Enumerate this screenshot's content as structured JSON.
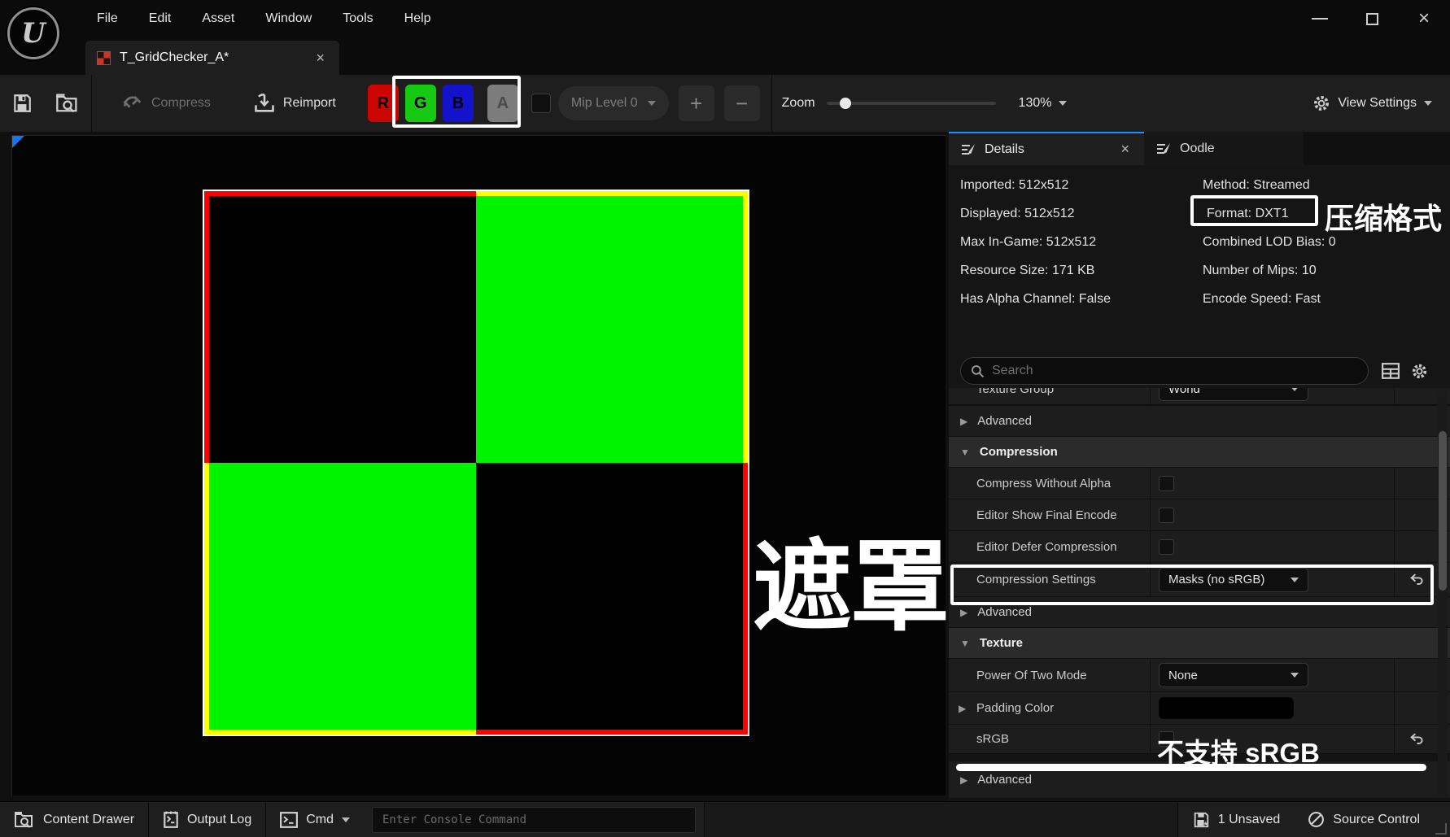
{
  "window": {
    "menu": [
      "File",
      "Edit",
      "Asset",
      "Window",
      "Tools",
      "Help"
    ],
    "logo_letter": "U"
  },
  "asset_tab": {
    "title": "T_GridChecker_A*"
  },
  "toolbar": {
    "compress_label": "Compress",
    "reimport_label": "Reimport",
    "channels": [
      {
        "label": "R",
        "color": "#cc0500"
      },
      {
        "label": "G",
        "color": "#17c913"
      },
      {
        "label": "B",
        "color": "#1512cc"
      },
      {
        "label": "A",
        "color": "#7c7c7c"
      }
    ],
    "mip_level": "Mip Level 0",
    "zoom_label": "Zoom",
    "zoom_value": "130%",
    "view_settings_label": "View Settings"
  },
  "details": {
    "tabs": {
      "details": "Details",
      "oodle": "Oodle"
    },
    "info_left": [
      "Imported: 512x512",
      "Displayed: 512x512",
      "Max In-Game: 512x512",
      "Resource Size: 171 KB",
      "Has Alpha Channel: False"
    ],
    "info_right": [
      "Method: Streamed",
      "Format: DXT1",
      "Combined LOD Bias: 0",
      "Number of Mips: 10",
      "Encode Speed: Fast"
    ],
    "search_placeholder": "Search",
    "properties": {
      "clipped_row": {
        "label": "Texture Group",
        "value": "World"
      },
      "advanced_label": "Advanced",
      "compression": {
        "header": "Compression",
        "rows": [
          {
            "label": "Compress Without Alpha",
            "type": "checkbox"
          },
          {
            "label": "Editor Show Final Encode",
            "type": "checkbox"
          },
          {
            "label": "Editor Defer Compression",
            "type": "checkbox"
          },
          {
            "label": "Compression Settings",
            "type": "dropdown",
            "value": "Masks (no sRGB)"
          }
        ]
      },
      "texture": {
        "header": "Texture",
        "rows": [
          {
            "label": "Power Of Two Mode",
            "type": "dropdown",
            "value": "None"
          },
          {
            "label": "Padding Color",
            "type": "color",
            "value": "#000000"
          },
          {
            "label": "sRGB",
            "type": "checkbox"
          }
        ]
      }
    }
  },
  "statusbar": {
    "content_drawer": "Content Drawer",
    "output_log": "Output Log",
    "cmd": "Cmd",
    "console_placeholder": "Enter Console Command",
    "unsaved": "1 Unsaved",
    "source_control": "Source Control"
  },
  "annotations": {
    "format_label": "压缩格式",
    "mask_label": "遮罩",
    "srgb_label": "不支持 sRGB"
  },
  "icons": {
    "collapsed": "▶",
    "expanded": "▼",
    "close": "×",
    "maximize": "□",
    "plus": "+",
    "minus": "−"
  },
  "colors": {
    "accent_blue": "#1f8fff",
    "texture_black": "#000000",
    "texture_green": "#00f400",
    "border_red": "#ff0000",
    "border_yellow": "#fbff00",
    "annotation_white": "#ffffff"
  }
}
